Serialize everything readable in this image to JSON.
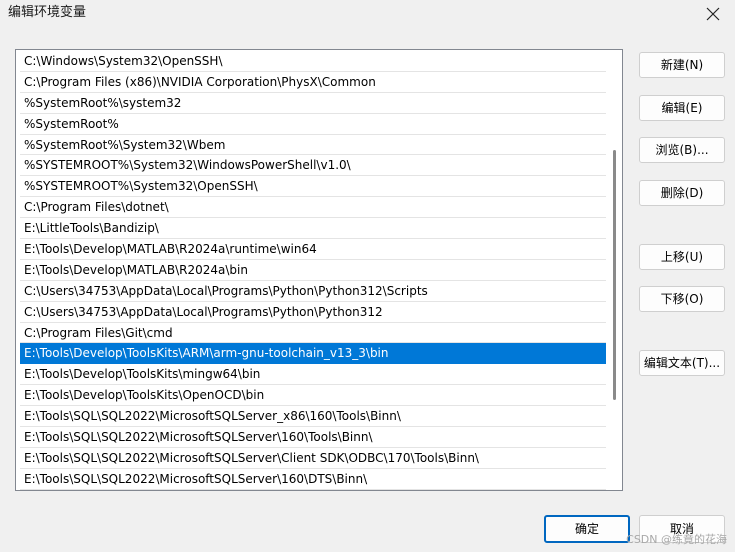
{
  "window": {
    "title": "编辑环境变量",
    "close_icon": "close-icon"
  },
  "path_list": {
    "selected_index": 14,
    "items": [
      "C:\\Windows\\System32\\OpenSSH\\",
      "C:\\Program Files (x86)\\NVIDIA Corporation\\PhysX\\Common",
      "%SystemRoot%\\system32",
      "%SystemRoot%",
      "%SystemRoot%\\System32\\Wbem",
      "%SYSTEMROOT%\\System32\\WindowsPowerShell\\v1.0\\",
      "%SYSTEMROOT%\\System32\\OpenSSH\\",
      "C:\\Program Files\\dotnet\\",
      "E:\\LittleTools\\Bandizip\\",
      "E:\\Tools\\Develop\\MATLAB\\R2024a\\runtime\\win64",
      "E:\\Tools\\Develop\\MATLAB\\R2024a\\bin",
      "C:\\Users\\34753\\AppData\\Local\\Programs\\Python\\Python312\\Scripts",
      "C:\\Users\\34753\\AppData\\Local\\Programs\\Python\\Python312",
      "C:\\Program Files\\Git\\cmd",
      "E:\\Tools\\Develop\\ToolsKits\\ARM\\arm-gnu-toolchain_v13_3\\bin",
      "E:\\Tools\\Develop\\ToolsKits\\mingw64\\bin",
      "E:\\Tools\\Develop\\ToolsKits\\OpenOCD\\bin",
      "E:\\Tools\\SQL\\SQL2022\\MicrosoftSQLServer_x86\\160\\Tools\\Binn\\",
      "E:\\Tools\\SQL\\SQL2022\\MicrosoftSQLServer\\160\\Tools\\Binn\\",
      "E:\\Tools\\SQL\\SQL2022\\MicrosoftSQLServer\\Client SDK\\ODBC\\170\\Tools\\Binn\\",
      "E:\\Tools\\SQL\\SQL2022\\MicrosoftSQLServer\\160\\DTS\\Binn\\"
    ]
  },
  "buttons": {
    "new": "新建(N)",
    "edit": "编辑(E)",
    "browse": "浏览(B)...",
    "delete": "删除(D)",
    "move_up": "上移(U)",
    "move_down": "下移(O)",
    "edit_text": "编辑文本(T)..."
  },
  "footer": {
    "ok": "确定",
    "cancel": "取消"
  },
  "watermark": "CSDN @练竟的花海",
  "colors": {
    "selection": "#0078d7",
    "ok_border": "#0067c0"
  }
}
